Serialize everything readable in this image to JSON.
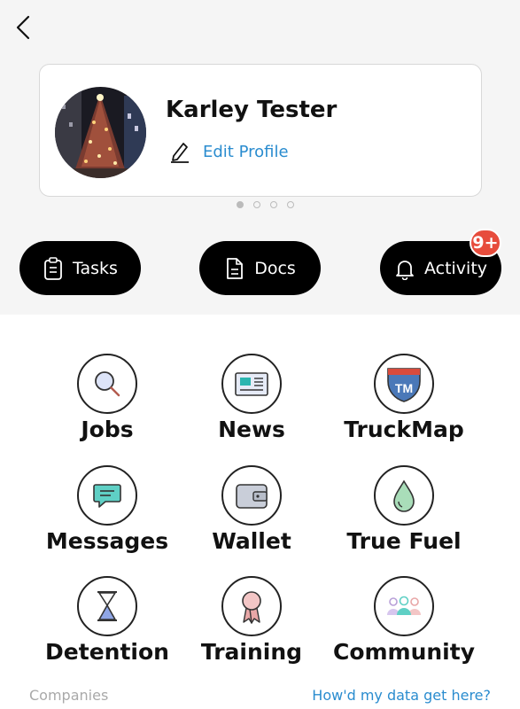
{
  "profile": {
    "name": "Karley Tester",
    "edit_label": "Edit Profile",
    "avatar_icon": "christmas-tree-photo"
  },
  "pager": {
    "count": 4,
    "active_index": 0
  },
  "quick_actions": {
    "tasks_label": "Tasks",
    "docs_label": "Docs",
    "activity_label": "Activity",
    "activity_badge": "9+"
  },
  "grid": {
    "jobs": "Jobs",
    "news": "News",
    "truckmap": "TruckMap",
    "messages": "Messages",
    "wallet": "Wallet",
    "true_fuel": "True Fuel",
    "detention": "Detention",
    "training": "Training",
    "community": "Community"
  },
  "footer": {
    "companies": "Companies",
    "data_link": "How'd my data get here?"
  },
  "colors": {
    "accent_blue": "#2a8ccf",
    "badge_red": "#e74c3c",
    "pill_black": "#000000"
  }
}
